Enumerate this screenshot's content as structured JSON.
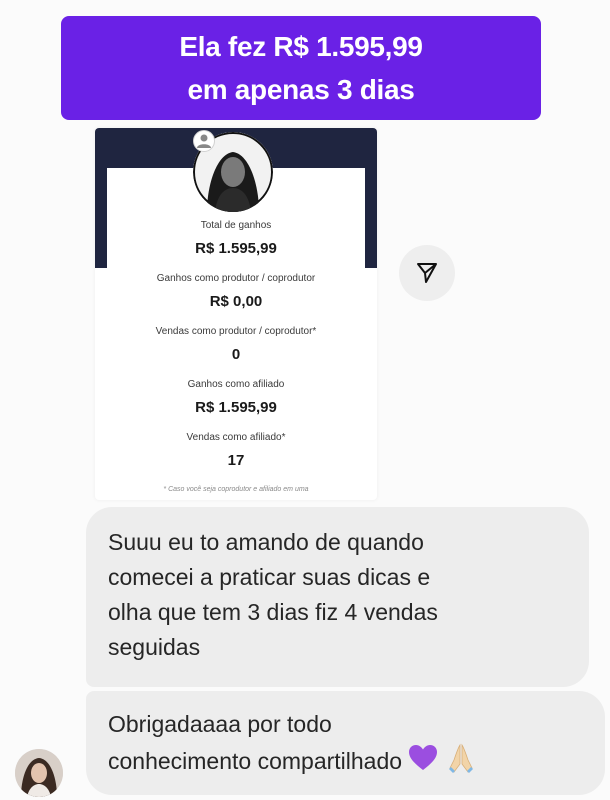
{
  "banner": {
    "line1": "Ela fez R$ 1.595,99",
    "line2": "em apenas 3 dias",
    "color": "#6a21e6"
  },
  "earnings_card": {
    "stats": [
      {
        "label": "Total de ganhos",
        "value": "R$ 1.595,99"
      },
      {
        "label": "Ganhos como produtor / coprodutor",
        "value": "R$ 0,00"
      },
      {
        "label": "Vendas como produtor / coprodutor*",
        "value": "0"
      },
      {
        "label": "Ganhos como afiliado",
        "value": "R$ 1.595,99"
      },
      {
        "label": "Vendas como afiliado*",
        "value": "17"
      }
    ],
    "footnote": "* Caso você seja coprodutor e afiliado em uma",
    "header_color": "#1f2540"
  },
  "share_icon": "send-icon",
  "messages": [
    {
      "lines": [
        "Suuu eu to amando de quando",
        "comecei a praticar suas dicas e",
        "olha que tem 3 dias fiz 4 vendas",
        "seguidas"
      ]
    },
    {
      "lines": [
        "Obrigadaaaa por todo",
        "conhecimento compartilhado"
      ],
      "emojis": [
        "purple-heart",
        "folded-hands"
      ]
    }
  ],
  "bubble_color": "#ededed"
}
